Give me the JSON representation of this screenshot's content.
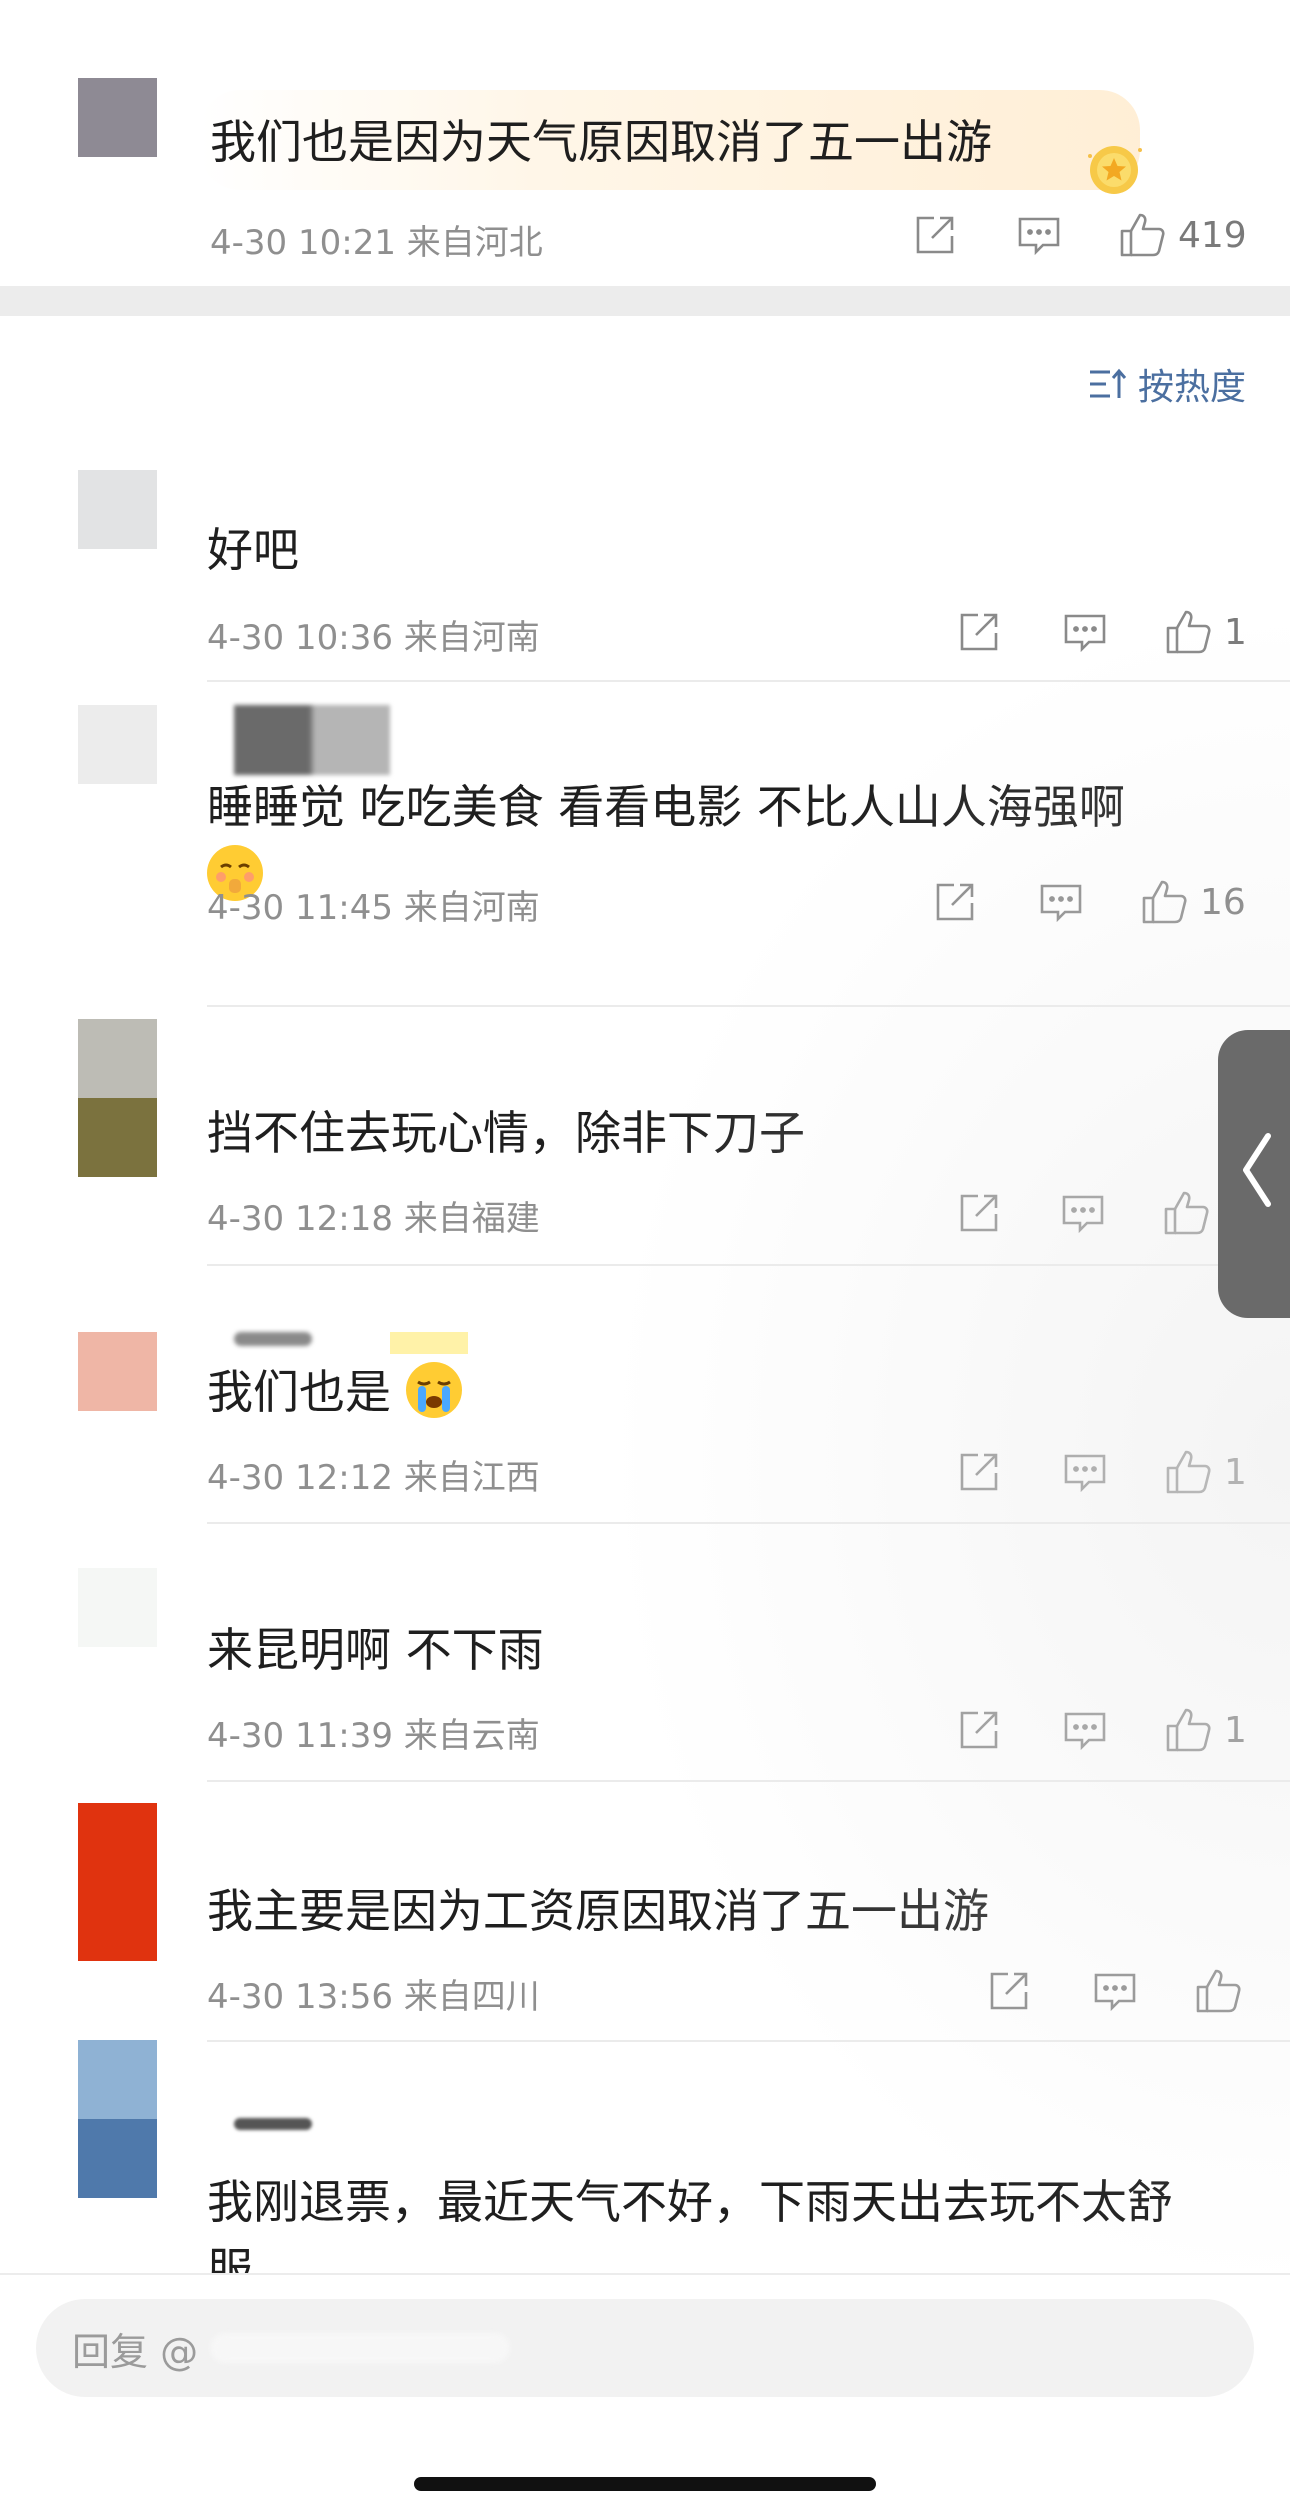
{
  "root_comment": {
    "text": "我们也是因为天气原因取消了五一出游",
    "time": "4-30 10:21",
    "location": "来自河北",
    "likes": "419",
    "avatar_color": "#8e8a94"
  },
  "sort": {
    "label": "按热度"
  },
  "replies": [
    {
      "text": "好吧",
      "time": "4-30 10:36",
      "location": "来自河南",
      "likes": "1"
    },
    {
      "text": "睡睡觉 吃吃美食  看看电影  不比人山人海强啊",
      "emoji": "shushing-face",
      "time": "4-30 11:45",
      "location": "来自河南",
      "likes": "16"
    },
    {
      "text": "挡不住去玩心情，除非下刀子",
      "time": "4-30 12:18",
      "location": "来自福建",
      "likes": ""
    },
    {
      "text": "我们也是",
      "emoji": "crying-face",
      "time": "4-30 12:12",
      "location": "来自江西",
      "likes": "1"
    },
    {
      "text": "来昆明啊 不下雨",
      "time": "4-30 11:39",
      "location": "来自云南",
      "likes": "1"
    },
    {
      "text": "我主要是因为工资原因取消了五一出游",
      "time": "4-30 13:56",
      "location": "来自四川",
      "likes": ""
    },
    {
      "text": "我刚退票，最近天气不好，下雨天出去玩不太舒服。"
    }
  ],
  "bottom_bar": {
    "placeholder": "回复 @"
  },
  "icons": [
    "repost-icon",
    "comment-icon",
    "like-icon",
    "sort-icon",
    "back-chevron-icon",
    "gold-badge-icon"
  ],
  "colors": {
    "accent_blue": "#4b6fa0",
    "meta_gray": "#8f8f8f",
    "separator": "#ececec"
  }
}
